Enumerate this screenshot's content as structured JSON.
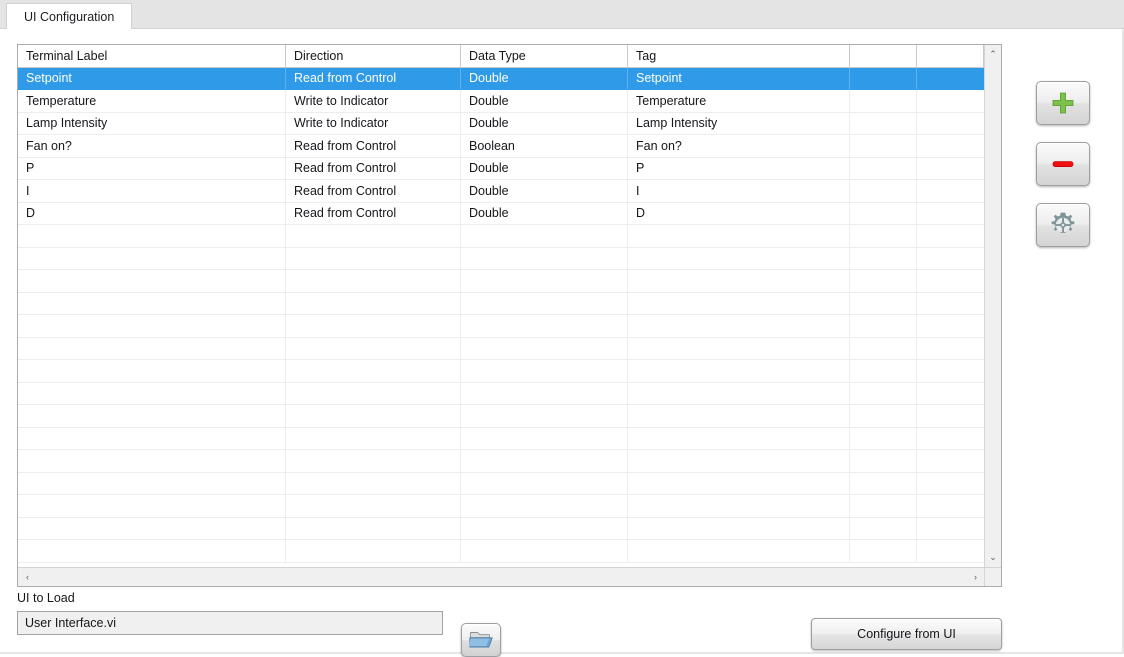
{
  "tab": {
    "label": "UI Configuration"
  },
  "table": {
    "columns": [
      "Terminal Label",
      "Direction",
      "Data Type",
      "Tag",
      "",
      ""
    ],
    "rows": [
      {
        "terminal_label": "Setpoint",
        "direction": "Read from Control",
        "data_type": "Double",
        "tag": "Setpoint",
        "extra1": "",
        "extra2": "",
        "selected": true
      },
      {
        "terminal_label": "Temperature",
        "direction": "Write to Indicator",
        "data_type": "Double",
        "tag": "Temperature",
        "extra1": "",
        "extra2": "",
        "selected": false
      },
      {
        "terminal_label": "Lamp Intensity",
        "direction": "Write to Indicator",
        "data_type": "Double",
        "tag": "Lamp Intensity",
        "extra1": "",
        "extra2": "",
        "selected": false
      },
      {
        "terminal_label": "Fan on?",
        "direction": "Read from Control",
        "data_type": "Boolean",
        "tag": "Fan on?",
        "extra1": "",
        "extra2": "",
        "selected": false
      },
      {
        "terminal_label": "P",
        "direction": "Read from Control",
        "data_type": "Double",
        "tag": "P",
        "extra1": "",
        "extra2": "",
        "selected": false
      },
      {
        "terminal_label": "I",
        "direction": "Read from Control",
        "data_type": "Double",
        "tag": "I",
        "extra1": "",
        "extra2": "",
        "selected": false
      },
      {
        "terminal_label": "D",
        "direction": "Read from Control",
        "data_type": "Double",
        "tag": "D",
        "extra1": "",
        "extra2": "",
        "selected": false
      }
    ],
    "empty_row_count": 15,
    "selection_color": "#2f9ae8"
  },
  "side_buttons": [
    {
      "name": "add-row-button",
      "icon": "plus-icon",
      "color": "#7cc24a"
    },
    {
      "name": "remove-row-button",
      "icon": "minus-icon",
      "color": "#f01010"
    },
    {
      "name": "configure-row-button",
      "icon": "gear-icon",
      "color": "#7d9499"
    }
  ],
  "bottom": {
    "ui_to_load_label": "UI to Load",
    "ui_path_value": "User Interface.vi",
    "browse_icon": "folder-open-icon",
    "configure_button_label": "Configure from UI"
  },
  "scrollbars": {
    "up_arrow": "⌃",
    "down_arrow": "⌄",
    "left_arrow": "‹",
    "right_arrow": "›"
  }
}
